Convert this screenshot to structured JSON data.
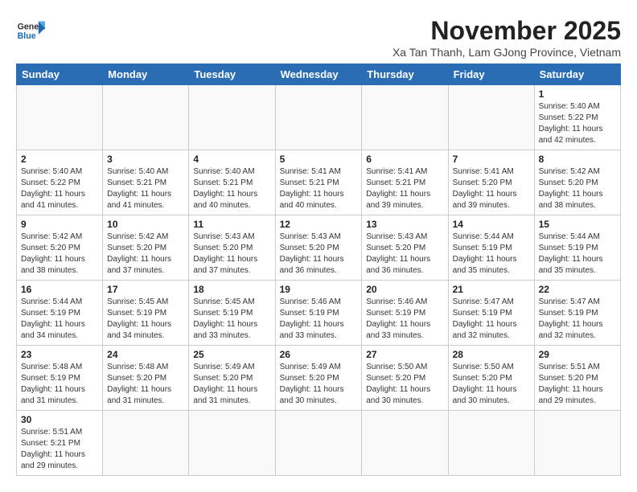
{
  "header": {
    "logo_text_general": "General",
    "logo_text_blue": "Blue",
    "month_title": "November 2025",
    "location": "Xa Tan Thanh, Lam GJong Province, Vietnam"
  },
  "weekdays": [
    "Sunday",
    "Monday",
    "Tuesday",
    "Wednesday",
    "Thursday",
    "Friday",
    "Saturday"
  ],
  "weeks": [
    [
      {
        "day": "",
        "info": ""
      },
      {
        "day": "",
        "info": ""
      },
      {
        "day": "",
        "info": ""
      },
      {
        "day": "",
        "info": ""
      },
      {
        "day": "",
        "info": ""
      },
      {
        "day": "",
        "info": ""
      },
      {
        "day": "1",
        "info": "Sunrise: 5:40 AM\nSunset: 5:22 PM\nDaylight: 11 hours\nand 42 minutes."
      }
    ],
    [
      {
        "day": "2",
        "info": "Sunrise: 5:40 AM\nSunset: 5:22 PM\nDaylight: 11 hours\nand 41 minutes."
      },
      {
        "day": "3",
        "info": "Sunrise: 5:40 AM\nSunset: 5:21 PM\nDaylight: 11 hours\nand 41 minutes."
      },
      {
        "day": "4",
        "info": "Sunrise: 5:40 AM\nSunset: 5:21 PM\nDaylight: 11 hours\nand 40 minutes."
      },
      {
        "day": "5",
        "info": "Sunrise: 5:41 AM\nSunset: 5:21 PM\nDaylight: 11 hours\nand 40 minutes."
      },
      {
        "day": "6",
        "info": "Sunrise: 5:41 AM\nSunset: 5:21 PM\nDaylight: 11 hours\nand 39 minutes."
      },
      {
        "day": "7",
        "info": "Sunrise: 5:41 AM\nSunset: 5:20 PM\nDaylight: 11 hours\nand 39 minutes."
      },
      {
        "day": "8",
        "info": "Sunrise: 5:42 AM\nSunset: 5:20 PM\nDaylight: 11 hours\nand 38 minutes."
      }
    ],
    [
      {
        "day": "9",
        "info": "Sunrise: 5:42 AM\nSunset: 5:20 PM\nDaylight: 11 hours\nand 38 minutes."
      },
      {
        "day": "10",
        "info": "Sunrise: 5:42 AM\nSunset: 5:20 PM\nDaylight: 11 hours\nand 37 minutes."
      },
      {
        "day": "11",
        "info": "Sunrise: 5:43 AM\nSunset: 5:20 PM\nDaylight: 11 hours\nand 37 minutes."
      },
      {
        "day": "12",
        "info": "Sunrise: 5:43 AM\nSunset: 5:20 PM\nDaylight: 11 hours\nand 36 minutes."
      },
      {
        "day": "13",
        "info": "Sunrise: 5:43 AM\nSunset: 5:20 PM\nDaylight: 11 hours\nand 36 minutes."
      },
      {
        "day": "14",
        "info": "Sunrise: 5:44 AM\nSunset: 5:19 PM\nDaylight: 11 hours\nand 35 minutes."
      },
      {
        "day": "15",
        "info": "Sunrise: 5:44 AM\nSunset: 5:19 PM\nDaylight: 11 hours\nand 35 minutes."
      }
    ],
    [
      {
        "day": "16",
        "info": "Sunrise: 5:44 AM\nSunset: 5:19 PM\nDaylight: 11 hours\nand 34 minutes."
      },
      {
        "day": "17",
        "info": "Sunrise: 5:45 AM\nSunset: 5:19 PM\nDaylight: 11 hours\nand 34 minutes."
      },
      {
        "day": "18",
        "info": "Sunrise: 5:45 AM\nSunset: 5:19 PM\nDaylight: 11 hours\nand 33 minutes."
      },
      {
        "day": "19",
        "info": "Sunrise: 5:46 AM\nSunset: 5:19 PM\nDaylight: 11 hours\nand 33 minutes."
      },
      {
        "day": "20",
        "info": "Sunrise: 5:46 AM\nSunset: 5:19 PM\nDaylight: 11 hours\nand 33 minutes."
      },
      {
        "day": "21",
        "info": "Sunrise: 5:47 AM\nSunset: 5:19 PM\nDaylight: 11 hours\nand 32 minutes."
      },
      {
        "day": "22",
        "info": "Sunrise: 5:47 AM\nSunset: 5:19 PM\nDaylight: 11 hours\nand 32 minutes."
      }
    ],
    [
      {
        "day": "23",
        "info": "Sunrise: 5:48 AM\nSunset: 5:19 PM\nDaylight: 11 hours\nand 31 minutes."
      },
      {
        "day": "24",
        "info": "Sunrise: 5:48 AM\nSunset: 5:20 PM\nDaylight: 11 hours\nand 31 minutes."
      },
      {
        "day": "25",
        "info": "Sunrise: 5:49 AM\nSunset: 5:20 PM\nDaylight: 11 hours\nand 31 minutes."
      },
      {
        "day": "26",
        "info": "Sunrise: 5:49 AM\nSunset: 5:20 PM\nDaylight: 11 hours\nand 30 minutes."
      },
      {
        "day": "27",
        "info": "Sunrise: 5:50 AM\nSunset: 5:20 PM\nDaylight: 11 hours\nand 30 minutes."
      },
      {
        "day": "28",
        "info": "Sunrise: 5:50 AM\nSunset: 5:20 PM\nDaylight: 11 hours\nand 30 minutes."
      },
      {
        "day": "29",
        "info": "Sunrise: 5:51 AM\nSunset: 5:20 PM\nDaylight: 11 hours\nand 29 minutes."
      }
    ],
    [
      {
        "day": "30",
        "info": "Sunrise: 5:51 AM\nSunset: 5:21 PM\nDaylight: 11 hours\nand 29 minutes."
      },
      {
        "day": "",
        "info": ""
      },
      {
        "day": "",
        "info": ""
      },
      {
        "day": "",
        "info": ""
      },
      {
        "day": "",
        "info": ""
      },
      {
        "day": "",
        "info": ""
      },
      {
        "day": "",
        "info": ""
      }
    ]
  ]
}
